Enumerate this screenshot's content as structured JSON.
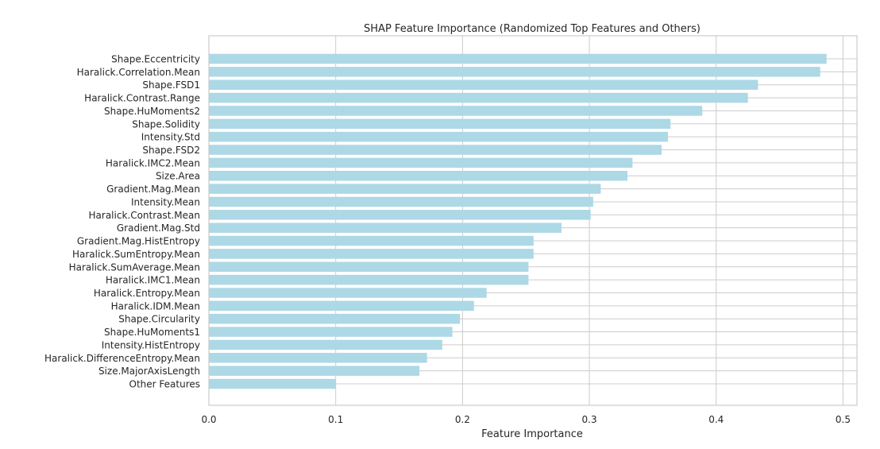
{
  "chart_data": {
    "type": "bar",
    "orientation": "horizontal",
    "title": "SHAP Feature Importance (Randomized Top Features and Others)",
    "xlabel": "Feature Importance",
    "ylabel": "",
    "xlim": [
      0.0,
      0.511
    ],
    "xticks": [
      0.0,
      0.1,
      0.2,
      0.3,
      0.4,
      0.5
    ],
    "xtick_labels": [
      "0.0",
      "0.1",
      "0.2",
      "0.3",
      "0.4",
      "0.5"
    ],
    "grid": true,
    "bar_color": "#add8e6",
    "grid_color": "#cccccc",
    "categories": [
      "Shape.Eccentricity",
      "Haralick.Correlation.Mean",
      "Shape.FSD1",
      "Haralick.Contrast.Range",
      "Shape.HuMoments2",
      "Shape.Solidity",
      "Intensity.Std",
      "Shape.FSD2",
      "Haralick.IMC2.Mean",
      "Size.Area",
      "Gradient.Mag.Mean",
      "Intensity.Mean",
      "Haralick.Contrast.Mean",
      "Gradient.Mag.Std",
      "Gradient.Mag.HistEntropy",
      "Haralick.SumEntropy.Mean",
      "Haralick.SumAverage.Mean",
      "Haralick.IMC1.Mean",
      "Haralick.Entropy.Mean",
      "Haralick.IDM.Mean",
      "Shape.Circularity",
      "Shape.HuMoments1",
      "Intensity.HistEntropy",
      "Haralick.DifferenceEntropy.Mean",
      "Size.MajorAxisLength",
      "Other Features"
    ],
    "values": [
      0.487,
      0.482,
      0.433,
      0.425,
      0.389,
      0.364,
      0.362,
      0.357,
      0.334,
      0.33,
      0.309,
      0.303,
      0.301,
      0.278,
      0.256,
      0.256,
      0.252,
      0.252,
      0.219,
      0.209,
      0.198,
      0.192,
      0.184,
      0.172,
      0.166,
      0.1
    ]
  }
}
